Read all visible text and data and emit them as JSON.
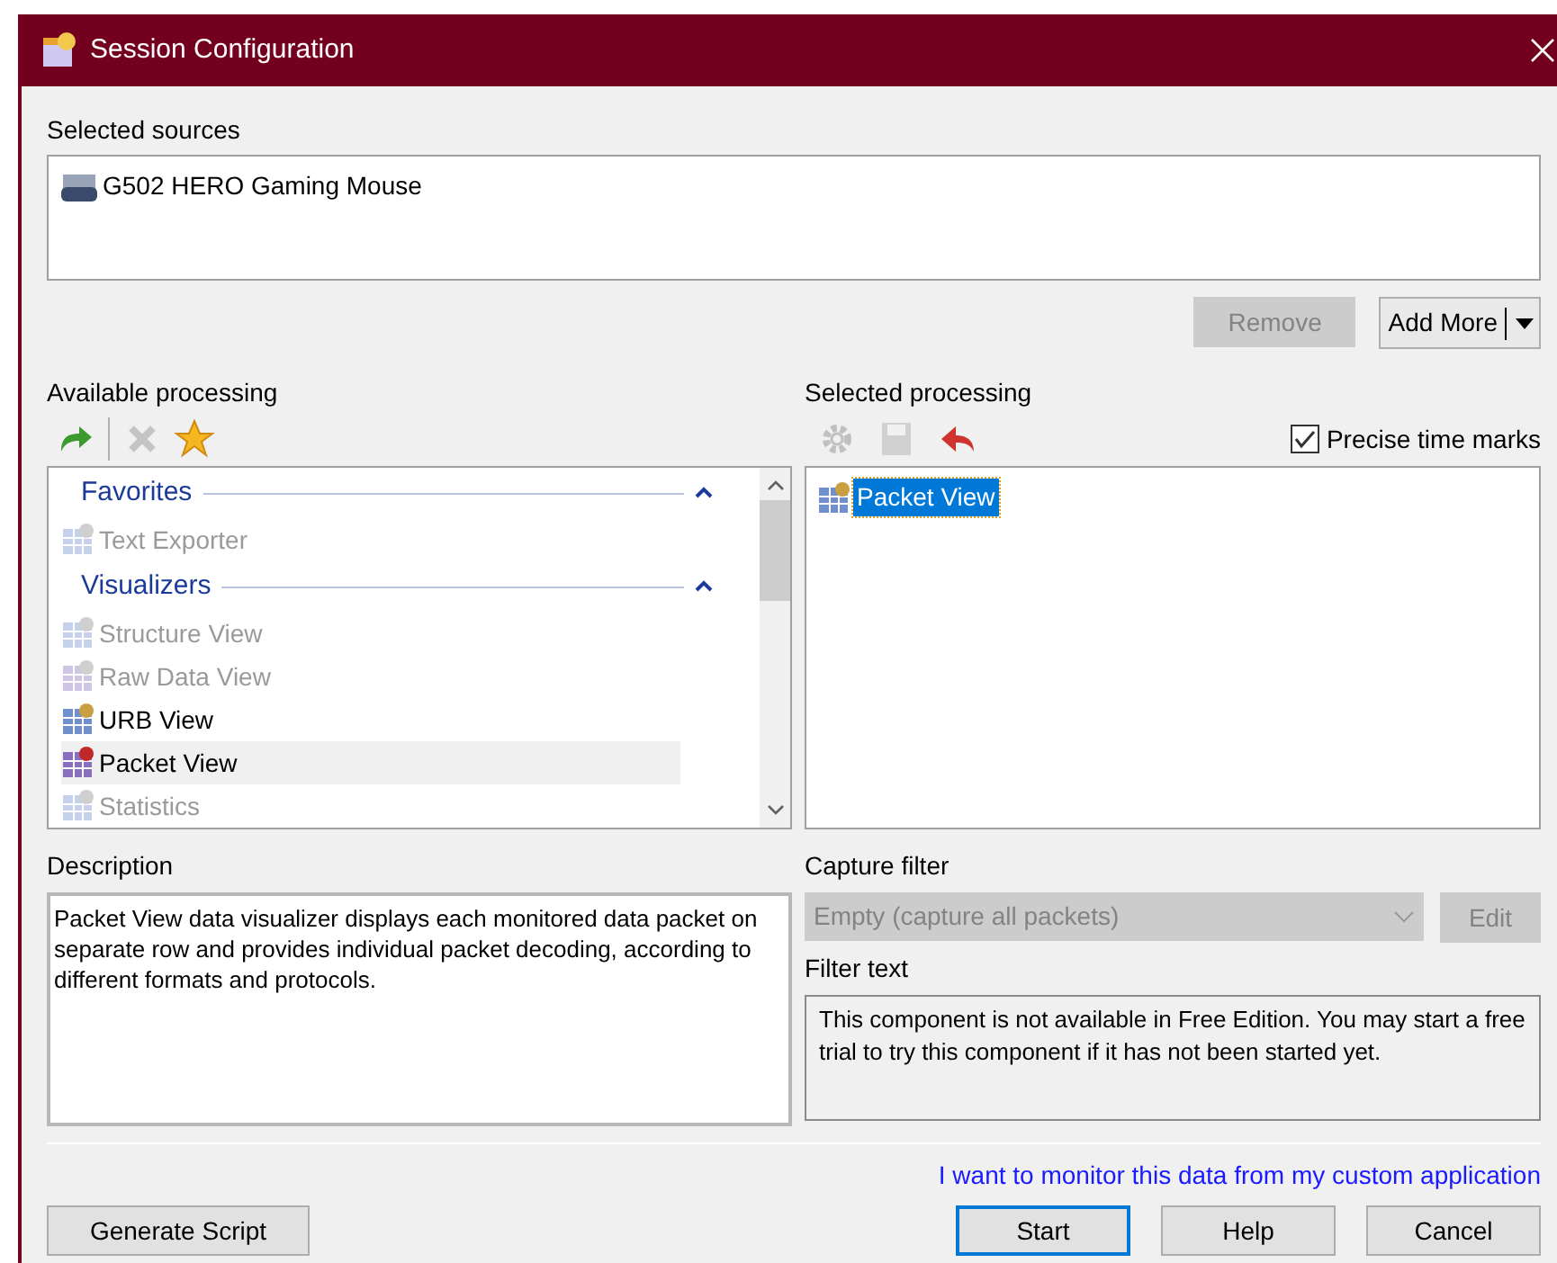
{
  "window": {
    "title": "Session Configuration"
  },
  "selected_sources": {
    "label": "Selected sources",
    "items": [
      {
        "name": "G502 HERO Gaming Mouse"
      }
    ]
  },
  "source_buttons": [
    {
      "label": "Remove",
      "disabled": true,
      "kind": "plain"
    },
    {
      "label": "Add More",
      "disabled": false,
      "kind": "split"
    }
  ],
  "available_processing": {
    "label": "Available processing",
    "groups": [
      {
        "title": "Favorites",
        "expanded": true,
        "items": [
          {
            "name": "Text Exporter",
            "disabled": true,
            "selected": false
          }
        ]
      },
      {
        "title": "Visualizers",
        "expanded": true,
        "items": [
          {
            "name": "Structure View",
            "disabled": true,
            "selected": false
          },
          {
            "name": "Raw Data View",
            "disabled": true,
            "selected": false
          },
          {
            "name": "URB View",
            "disabled": false,
            "selected": false
          },
          {
            "name": "Packet View",
            "disabled": false,
            "selected": true
          },
          {
            "name": "Statistics",
            "disabled": true,
            "selected": false
          }
        ]
      }
    ]
  },
  "selected_processing": {
    "label": "Selected processing",
    "precise_time_marks": {
      "label": "Precise time marks",
      "checked": true
    },
    "items": [
      {
        "name": "Packet View",
        "selected": true
      }
    ]
  },
  "description": {
    "label": "Description",
    "text": "Packet View data visualizer displays each monitored data packet on separate row and provides individual packet decoding, according to different formats and protocols."
  },
  "capture_filter": {
    "label": "Capture filter",
    "value": "Empty (capture all packets)",
    "disabled": true,
    "edit_button": {
      "label": "Edit",
      "disabled": true
    }
  },
  "filter_text": {
    "label": "Filter text",
    "text": "This component is not available in Free Edition. You may start a free trial to try this component if it has not been started yet."
  },
  "custom_app_link": "I want to monitor this data from my custom application",
  "buttons": [
    {
      "label": "Generate Script",
      "default": false
    },
    {
      "label": "Start",
      "default": true
    },
    {
      "label": "Help",
      "default": false
    },
    {
      "label": "Cancel",
      "default": false
    }
  ]
}
